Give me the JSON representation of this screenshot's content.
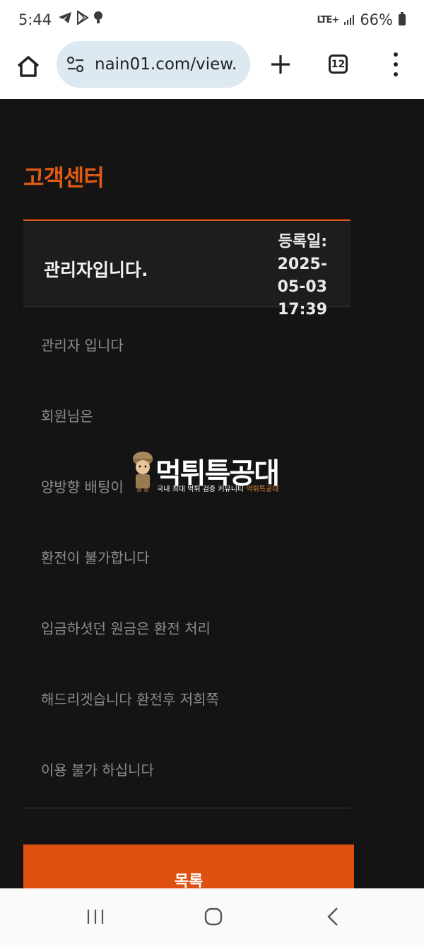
{
  "status_bar": {
    "time": "5:44",
    "network": "LTE+",
    "battery": "66%"
  },
  "browser": {
    "url": "nain01.com/view.",
    "tab_count": "12"
  },
  "page": {
    "title": "고객센터",
    "post_title": "관리자입니다.",
    "date_label": "등록일:",
    "date_value": "2025-05-03 17:39",
    "body_lines": [
      "관리자 입니다",
      "회원님은",
      "양방향 배팅이",
      "환전이 불가합니다",
      "입금하셧던 원금은 환전 처리",
      "해드리겟습니다 환전후 저희쪽",
      "이용 불가 하십니다"
    ],
    "list_button": "목록"
  },
  "watermark": {
    "title_main": "먹튀",
    "title_accent": "특공대",
    "subtitle_main": "국내 최대 먹튀 검증 커뮤니티",
    "subtitle_accent": "먹튀특공대"
  },
  "colors": {
    "accent": "#e05a16",
    "button": "#dd5010",
    "background": "#141414"
  }
}
